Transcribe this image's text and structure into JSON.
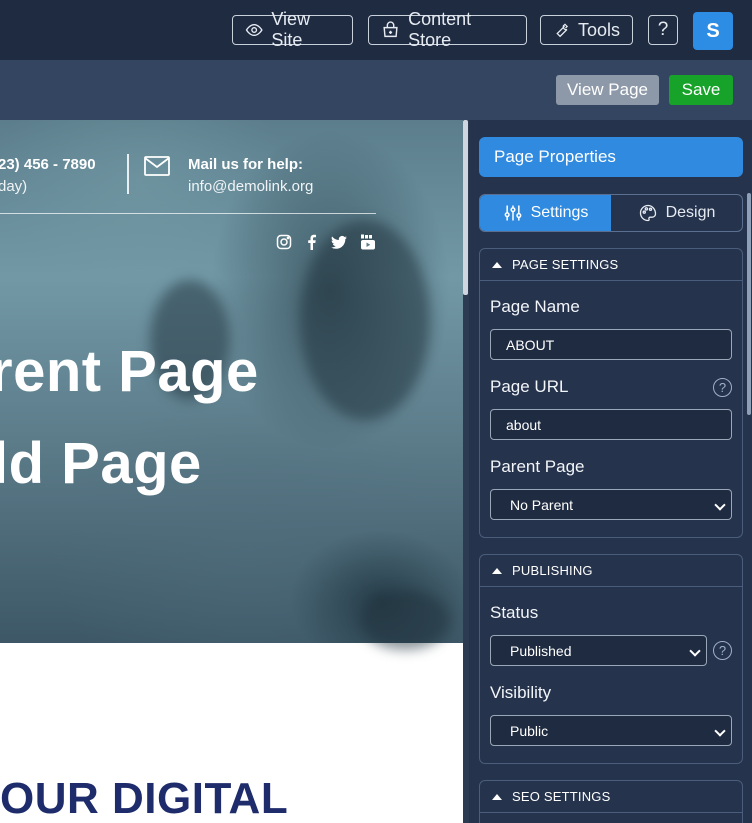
{
  "topbar": {
    "view_site": "View Site",
    "content_store": "Content Store",
    "tools": "Tools",
    "help": "?",
    "avatar_letter": "S"
  },
  "subbar": {
    "view_page": "View Page",
    "save": "Save"
  },
  "preview": {
    "phone": "23) 456 - 7890",
    "phone_sub": "day)",
    "mail_title": "Mail us for help:",
    "mail_address": "info@demolink.org",
    "hero_line1": "rent Page",
    "hero_line2": "ld Page",
    "section_heading": "OUR DIGITAL",
    "social_icons": [
      "instagram-icon",
      "facebook-icon",
      "twitter-icon",
      "youtube-icon"
    ]
  },
  "panel": {
    "title": "Page Properties",
    "tabs": [
      {
        "label": "Settings",
        "icon": "sliders-icon",
        "active": true
      },
      {
        "label": "Design",
        "icon": "palette-icon",
        "active": false
      }
    ],
    "page_settings": {
      "heading": "PAGE SETTINGS",
      "page_name_label": "Page Name",
      "page_name_value": "ABOUT",
      "page_url_label": "Page URL",
      "page_url_value": "about",
      "parent_page_label": "Parent Page",
      "parent_page_value": "No Parent",
      "help": "?"
    },
    "publishing": {
      "heading": "PUBLISHING",
      "status_label": "Status",
      "status_value": "Published",
      "visibility_label": "Visibility",
      "visibility_value": "Public",
      "help": "?"
    },
    "seo": {
      "heading": "SEO SETTINGS"
    }
  },
  "colors": {
    "topbar_bg": "#1f2b40",
    "subbar_bg": "#344562",
    "accent": "#2f8ae0",
    "save_green": "#17a329",
    "heading_navy": "#1e2c6b"
  }
}
